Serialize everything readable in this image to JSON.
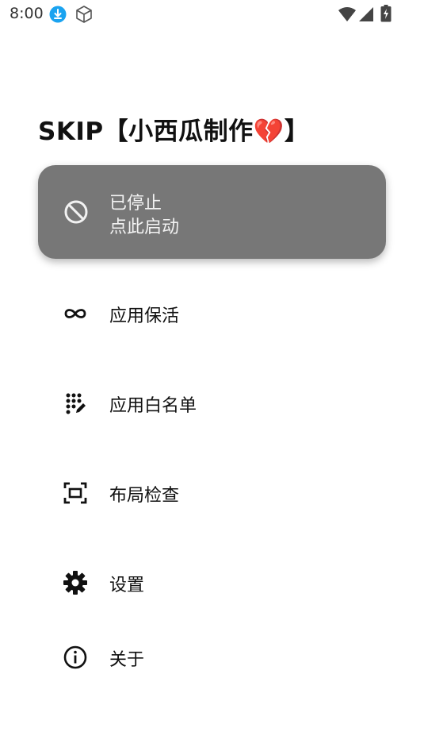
{
  "status_bar": {
    "time": "8:00",
    "icons": [
      "download-icon",
      "cube-icon",
      "wifi-icon",
      "signal-icon",
      "battery-charging-icon"
    ],
    "download_color": "#1aa3f0"
  },
  "app": {
    "title": "SKIP【小西瓜制作💔】"
  },
  "status_card": {
    "status": "已停止",
    "action": "点此启动",
    "icon": "block-icon",
    "background": "#777777"
  },
  "menu": {
    "items": [
      {
        "label": "应用保活",
        "icon": "infinity-icon"
      },
      {
        "label": "应用白名单",
        "icon": "dots-edit-icon"
      },
      {
        "label": "布局检查",
        "icon": "layout-frame-icon"
      },
      {
        "label": "设置",
        "icon": "gear-icon"
      },
      {
        "label": "关于",
        "icon": "info-icon"
      }
    ]
  }
}
